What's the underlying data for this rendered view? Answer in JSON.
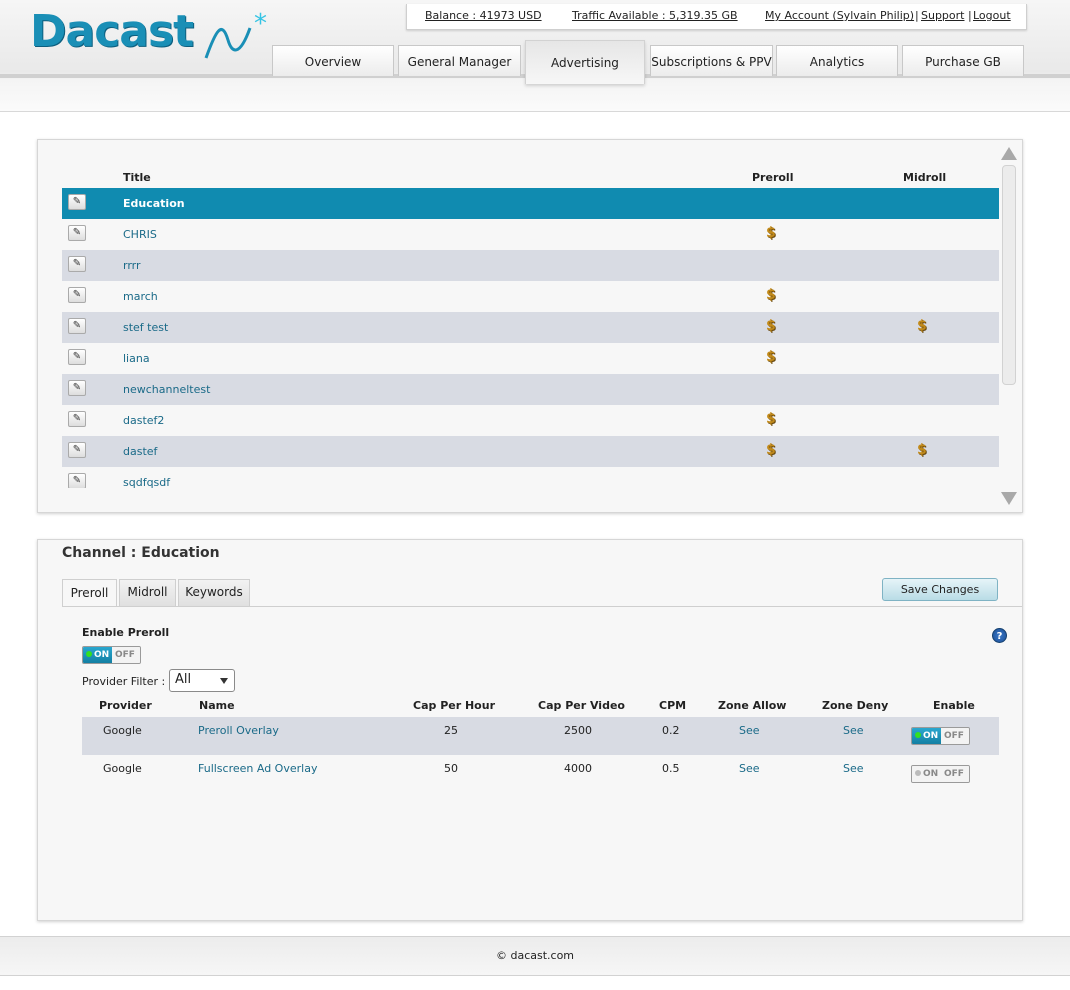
{
  "brand": {
    "name": "Dacast",
    "accent": "#1a8fb6",
    "logo_star": "*"
  },
  "account_bar": {
    "balance": "Balance : 41973 USD",
    "traffic": "Traffic Available : 5,319.35 GB",
    "my_account": "My Account (Sylvain Philip)",
    "sep1": "|",
    "support": "Support",
    "sep2": "|",
    "logout": "Logout"
  },
  "nav": {
    "tabs": [
      {
        "label": "Overview"
      },
      {
        "label": "General Manager"
      },
      {
        "label": "Advertising",
        "active": true
      },
      {
        "label": "Subscriptions & PPV"
      },
      {
        "label": "Analytics"
      },
      {
        "label": "Purchase GB"
      }
    ]
  },
  "channels": {
    "columns": {
      "title": "Title",
      "preroll": "Preroll",
      "midroll": "Midroll"
    },
    "edit_icon": "✎",
    "money_icon": "$",
    "rows": [
      {
        "title": "Education",
        "preroll": false,
        "midroll": false,
        "selected": true
      },
      {
        "title": "CHRIS",
        "preroll": true,
        "midroll": false
      },
      {
        "title": "rrrr",
        "preroll": false,
        "midroll": false
      },
      {
        "title": "march",
        "preroll": true,
        "midroll": false
      },
      {
        "title": "stef test",
        "preroll": true,
        "midroll": true
      },
      {
        "title": "liana",
        "preroll": true,
        "midroll": false
      },
      {
        "title": "newchanneltest",
        "preroll": false,
        "midroll": false
      },
      {
        "title": "dastef2",
        "preroll": true,
        "midroll": false
      },
      {
        "title": "dastef",
        "preroll": true,
        "midroll": true
      },
      {
        "title": "sqdfqsdf",
        "preroll": false,
        "midroll": false
      }
    ]
  },
  "channel_detail": {
    "title": "Channel : Education",
    "tabs": [
      {
        "label": "Preroll",
        "active": true
      },
      {
        "label": "Midroll"
      },
      {
        "label": "Keywords"
      }
    ],
    "save_label": "Save Changes",
    "help_label": "?",
    "enable_label": "Enable Preroll",
    "enable_toggle": {
      "on": "ON",
      "off": "OFF",
      "state": "on"
    },
    "filter_label": "Provider Filter :",
    "filter_value": "All",
    "ads_columns": {
      "provider": "Provider",
      "name": "Name",
      "cap_hour": "Cap Per Hour",
      "cap_video": "Cap Per Video",
      "cpm": "CPM",
      "zone_allow": "Zone Allow",
      "zone_deny": "Zone Deny",
      "enable": "Enable"
    },
    "ads": [
      {
        "provider": "Google",
        "name": "Preroll Overlay",
        "cap_hour": "25",
        "cap_video": "2500",
        "cpm": "0.2",
        "zone_allow": "See",
        "zone_deny": "See",
        "toggle_on": "ON",
        "toggle_off": "OFF",
        "enabled": true
      },
      {
        "provider": "Google",
        "name": "Fullscreen Ad Overlay",
        "cap_hour": "50",
        "cap_video": "4000",
        "cpm": "0.5",
        "zone_allow": "See",
        "zone_deny": "See",
        "toggle_on": "ON",
        "toggle_off": "OFF",
        "enabled": false
      }
    ]
  },
  "footer": {
    "text": "© dacast.com"
  }
}
